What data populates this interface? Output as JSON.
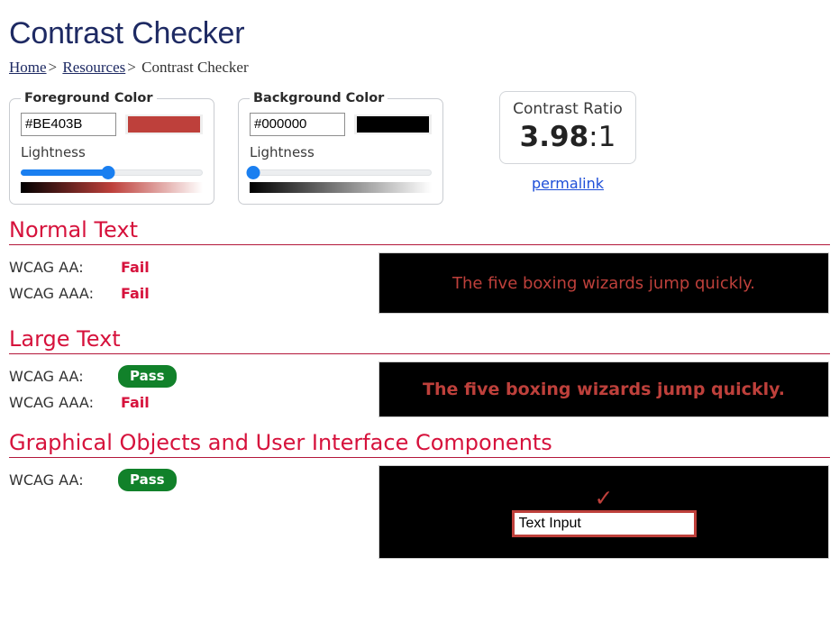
{
  "page": {
    "title": "Contrast Checker"
  },
  "breadcrumb": {
    "home": "Home",
    "separator1": ">",
    "resources": "Resources",
    "separator2": ">",
    "current": "Contrast Checker"
  },
  "foreground": {
    "legend": "Foreground Color",
    "hex_value": "#BE403B",
    "swatch_color": "#BE403B",
    "lightness_label": "Lightness",
    "slider_percent": 48,
    "gradient": "linear-gradient(to right, #000000 0%, #BE403B 50%, #ffffff 100%)"
  },
  "background": {
    "legend": "Background Color",
    "hex_value": "#000000",
    "swatch_color": "#000000",
    "lightness_label": "Lightness",
    "slider_percent": 2,
    "gradient": "linear-gradient(to right, #000000 0%, #808080 50%, #ffffff 100%)"
  },
  "ratio": {
    "label": "Contrast Ratio",
    "value": "3.98",
    "suffix": ":1",
    "permalink": "permalink"
  },
  "sections": [
    {
      "title": "Normal Text",
      "criteria": [
        {
          "label": "WCAG AA:",
          "verdict": "Fail",
          "status": "fail"
        },
        {
          "label": "WCAG AAA:",
          "verdict": "Fail",
          "status": "fail"
        }
      ],
      "sample_text": "The five boxing wizards jump quickly."
    },
    {
      "title": "Large Text",
      "criteria": [
        {
          "label": "WCAG AA:",
          "verdict": "Pass",
          "status": "pass"
        },
        {
          "label": "WCAG AAA:",
          "verdict": "Fail",
          "status": "fail"
        }
      ],
      "sample_text": "The five boxing wizards jump quickly."
    },
    {
      "title": "Graphical Objects and User Interface Components",
      "criteria": [
        {
          "label": "WCAG AA:",
          "verdict": "Pass",
          "status": "pass"
        }
      ],
      "check_icon": "✓",
      "input_value": "Text Input"
    }
  ],
  "colors": {
    "title": "#1e2a63",
    "heading_red": "#d6123c",
    "fail_red": "#d6123c",
    "pass_green": "#11812a",
    "link_blue": "#1d4ed8",
    "slider_blue": "#1a7ff0",
    "foreground": "#BE403B",
    "background": "#000000"
  }
}
